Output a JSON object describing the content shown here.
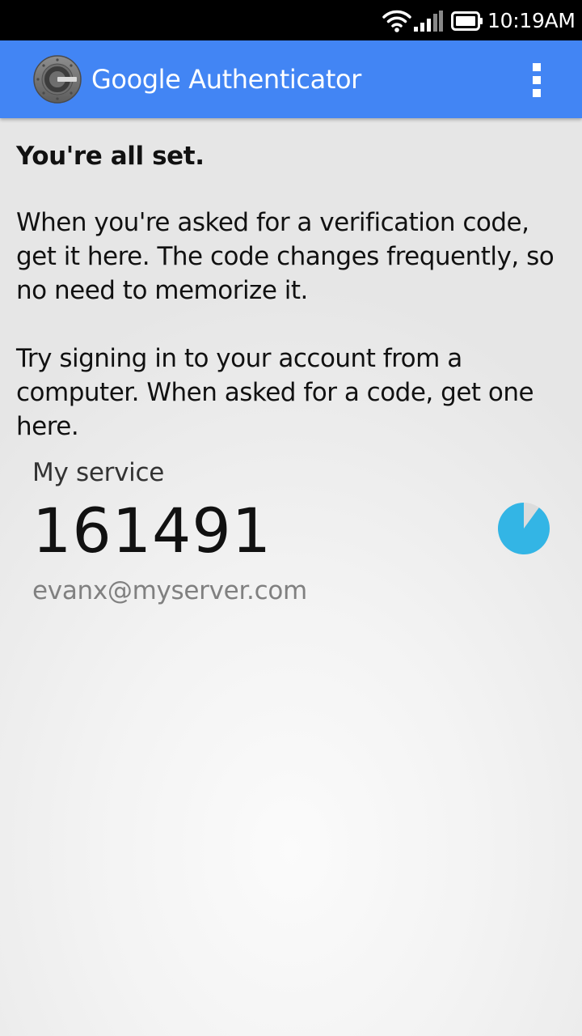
{
  "status_bar": {
    "time": "10:19AM",
    "icons": [
      "wifi-icon",
      "cell-signal-icon",
      "battery-icon"
    ]
  },
  "app_bar": {
    "title": "Google Authenticator",
    "color": "#4285f4",
    "logo_icon": "authenticator-logo",
    "menu_icon": "overflow-menu-icon"
  },
  "content": {
    "headline": "You're all set.",
    "paragraph1": "When you're asked for a verification code, get it here. The code changes frequently, so no need to memorize it.",
    "paragraph2": "Try signing in to your account from a computer. When asked for a code, get one here."
  },
  "account": {
    "issuer": "My service",
    "code": "161491",
    "user": "evanx@myserver.com",
    "timer_color": "#33b5e5",
    "timer_remaining_fraction": 0.9
  }
}
